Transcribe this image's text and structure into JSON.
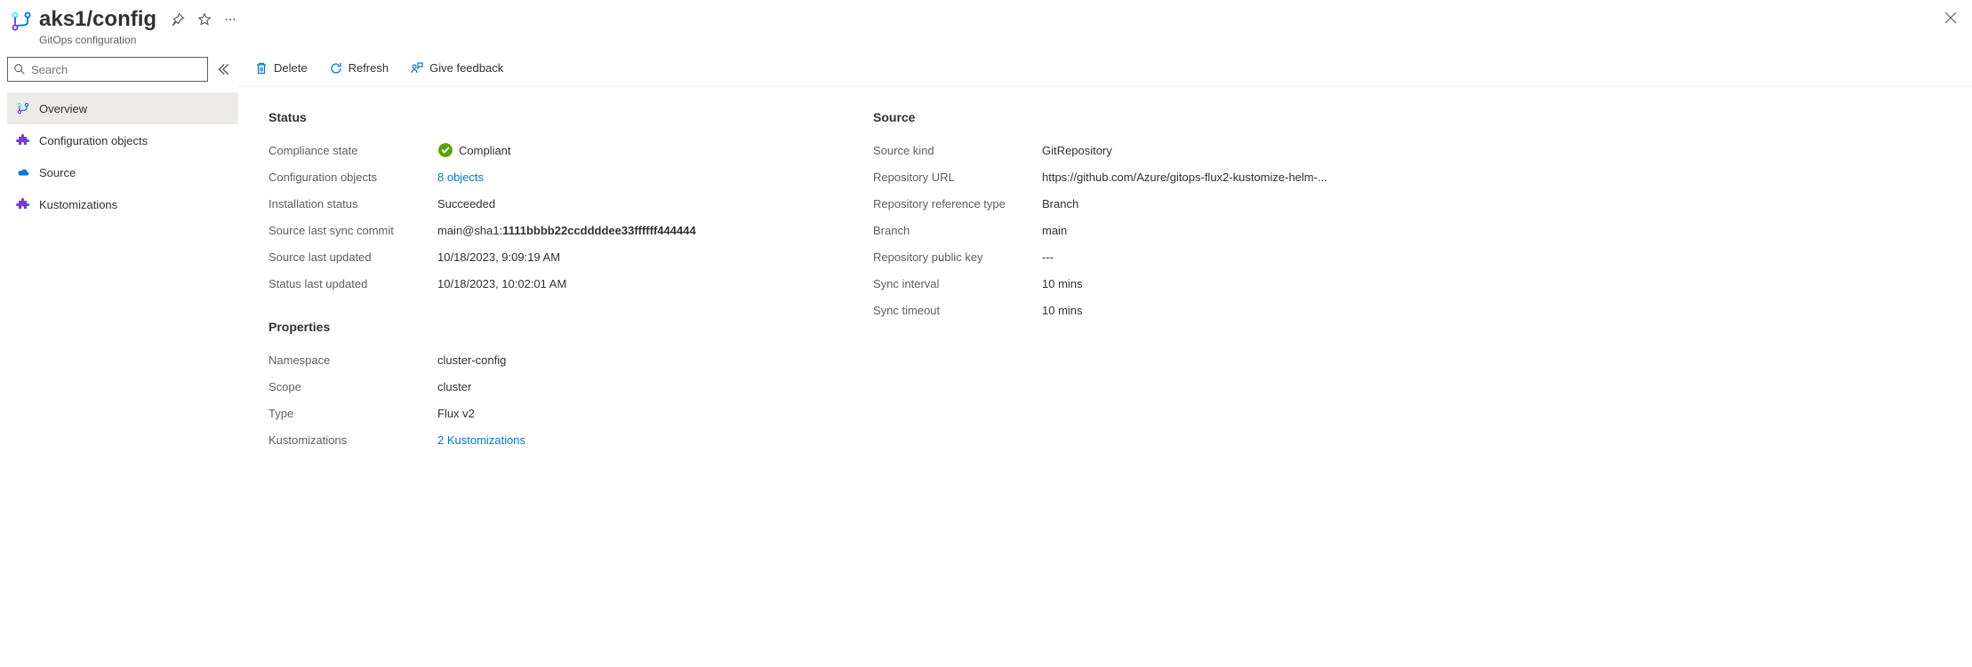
{
  "header": {
    "title": "aks1/config",
    "subtitle": "GitOps configuration"
  },
  "search": {
    "placeholder": "Search"
  },
  "sidebar": {
    "items": [
      {
        "label": "Overview"
      },
      {
        "label": "Configuration objects"
      },
      {
        "label": "Source"
      },
      {
        "label": "Kustomizations"
      }
    ]
  },
  "toolbar": {
    "delete": "Delete",
    "refresh": "Refresh",
    "feedback": "Give feedback"
  },
  "status": {
    "heading": "Status",
    "compliance_label": "Compliance state",
    "compliance_value": "Compliant",
    "config_objects_label": "Configuration objects",
    "config_objects_value": "8 objects",
    "install_status_label": "Installation status",
    "install_status_value": "Succeeded",
    "commit_label": "Source last sync commit",
    "commit_prefix": "main@sha1:",
    "commit_hash": "1111bbbb22ccddddee33ffffff444444",
    "src_updated_label": "Source last updated",
    "src_updated_value": "10/18/2023, 9:09:19 AM",
    "status_updated_label": "Status last updated",
    "status_updated_value": "10/18/2023, 10:02:01 AM"
  },
  "properties": {
    "heading": "Properties",
    "namespace_label": "Namespace",
    "namespace_value": "cluster-config",
    "scope_label": "Scope",
    "scope_value": "cluster",
    "type_label": "Type",
    "type_value": "Flux v2",
    "kustomizations_label": "Kustomizations",
    "kustomizations_value": "2 Kustomizations"
  },
  "source": {
    "heading": "Source",
    "kind_label": "Source kind",
    "kind_value": "GitRepository",
    "url_label": "Repository URL",
    "url_value": "https://github.com/Azure/gitops-flux2-kustomize-helm-...",
    "reftype_label": "Repository reference type",
    "reftype_value": "Branch",
    "branch_label": "Branch",
    "branch_value": "main",
    "pubkey_label": "Repository public key",
    "pubkey_value": "---",
    "sync_interval_label": "Sync interval",
    "sync_interval_value": "10 mins",
    "sync_timeout_label": "Sync timeout",
    "sync_timeout_value": "10 mins"
  }
}
